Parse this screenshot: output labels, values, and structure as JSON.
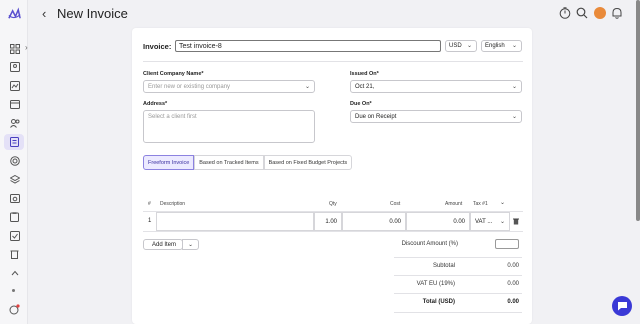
{
  "header": {
    "title": "New Invoice",
    "back_icon": "‹"
  },
  "invoice": {
    "label": "Invoice:",
    "name_value": "Test invoice-8",
    "currency": "USD",
    "language": "English"
  },
  "form": {
    "client_label": "Client Company Name*",
    "client_placeholder": "Enter new or existing company",
    "address_label": "Address*",
    "address_placeholder": "Select a client first",
    "issued_label": "Issued On*",
    "issued_value": "Oct 21,",
    "due_label": "Due On*",
    "due_value": "Due on Receipt"
  },
  "tabs": [
    "Freeform Invoice",
    "Based on Tracked Items",
    "Based on Fixed Budget Projects"
  ],
  "table": {
    "headers": {
      "num": "#",
      "description": "Description",
      "qty": "Qty",
      "cost": "Cost",
      "amount": "Amount",
      "tax": "Tax #1"
    },
    "rows": [
      {
        "num": "1",
        "description": "",
        "qty": "1.00",
        "cost": "0.00",
        "amount": "0.00",
        "tax": "VAT ..."
      }
    ]
  },
  "add_item_label": "Add Item",
  "summary": {
    "discount_label": "Discount Amount (%)",
    "subtotal_label": "Subtotal",
    "subtotal_value": "0.00",
    "vat_label": "VAT EU (19%)",
    "vat_value": "0.00",
    "total_label": "Total (USD)",
    "total_value": "0.00"
  },
  "colors": {
    "accent": "#3a39d6",
    "active_tab_bg": "#eceaff",
    "avatar": "#e98a3a"
  }
}
